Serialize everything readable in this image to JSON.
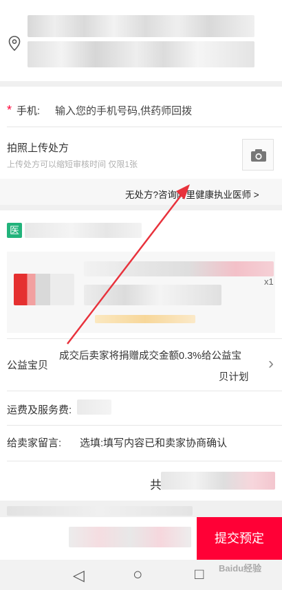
{
  "address": {
    "icon": "location-pin-icon"
  },
  "phone": {
    "required_mark": "*",
    "label": "手机:",
    "placeholder": "输入您的手机号码,供药师回拨"
  },
  "prescription": {
    "title": "拍照上传处方",
    "subtitle": "上传处方可以缩短审核时间 仅限1张",
    "camera_icon": "camera-icon",
    "consult_link": "无处方?咨询阿里健康执业医师 >"
  },
  "store": {
    "badge": "医"
  },
  "product": {
    "quantity": "x1"
  },
  "charity": {
    "label": "公益宝贝",
    "text_line1": "成交后卖家将捐赠成交金额0.3%给公益宝",
    "text_line2": "贝计划",
    "chevron": "›"
  },
  "shipping": {
    "label": "运费及服务费:"
  },
  "message": {
    "label": "给卖家留言:",
    "placeholder": "选填:填写内容已和卖家协商确认"
  },
  "summary": {
    "prefix": "共"
  },
  "bottom_bar": {
    "submit_label": "提交预定"
  },
  "nav": {
    "back": "◁",
    "home": "○",
    "recent": "□"
  },
  "watermark": "Baidu经验",
  "colors": {
    "accent": "#ff0036",
    "badge": "#22b37b",
    "arrow": "#e8323c"
  }
}
